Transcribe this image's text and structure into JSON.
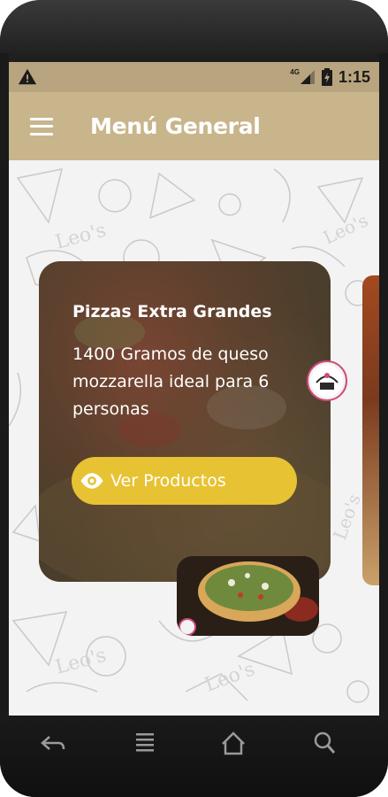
{
  "status_bar": {
    "network_label": "4G",
    "time": "1:15"
  },
  "app_bar": {
    "title": "Menú General"
  },
  "card": {
    "title": "Pizzas Extra Grandes",
    "description": "1400 Gramos de queso mozzarella ideal para 6 personas",
    "button_label": "Ver Productos"
  },
  "nav_bar": {
    "items": [
      "back-icon",
      "menu-icon",
      "home-icon",
      "search-icon"
    ]
  },
  "colors": {
    "status_bar": "#b8a47e",
    "app_bar": "#c9b58c",
    "button": "#e7c233",
    "text_on_dark": "#ffffff"
  }
}
